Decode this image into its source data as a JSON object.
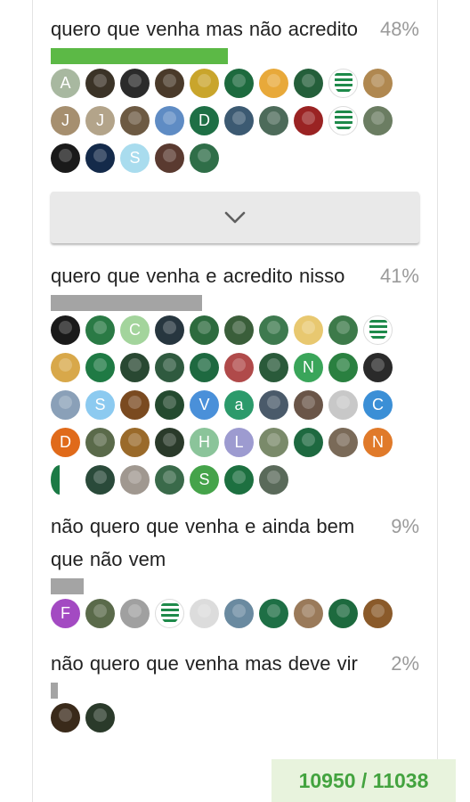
{
  "poll": {
    "options": [
      {
        "label": "quero que venha mas não acredito",
        "percent": "48%",
        "bar_fraction": 0.48,
        "bar_color": "#5cb946",
        "voters": [
          {
            "type": "initial",
            "text": "A",
            "color": "#a8b8a0"
          },
          {
            "type": "photo",
            "color": "#3b3327"
          },
          {
            "type": "photo",
            "color": "#2b2b2b"
          },
          {
            "type": "photo",
            "color": "#4a3a2a"
          },
          {
            "type": "photo",
            "color": "#c9a52c"
          },
          {
            "type": "photo",
            "color": "#1d6a3e"
          },
          {
            "type": "photo",
            "color": "#e8a93a"
          },
          {
            "type": "photo",
            "color": "#245f3a"
          },
          {
            "type": "crest"
          },
          {
            "type": "photo",
            "color": "#b08850"
          },
          {
            "type": "initial",
            "text": "J",
            "color": "#a68f6f"
          },
          {
            "type": "initial",
            "text": "J",
            "color": "#b3a48a"
          },
          {
            "type": "photo",
            "color": "#6d5a43"
          },
          {
            "type": "photo",
            "color": "#5f8cc4"
          },
          {
            "type": "initial",
            "text": "D",
            "color": "#1e6f45"
          },
          {
            "type": "photo",
            "color": "#3c5a72"
          },
          {
            "type": "photo",
            "color": "#4d6b5a"
          },
          {
            "type": "photo",
            "color": "#9a2323"
          },
          {
            "type": "crest"
          },
          {
            "type": "photo",
            "color": "#6b7d62"
          },
          {
            "type": "photo",
            "color": "#1a1a1a"
          },
          {
            "type": "photo",
            "color": "#142a4a"
          },
          {
            "type": "initial",
            "text": "S",
            "color": "#a9dcee"
          },
          {
            "type": "photo",
            "color": "#5a3a30"
          },
          {
            "type": "photo",
            "color": "#2f6e48"
          }
        ]
      },
      {
        "label": "quero que venha e acredito nisso",
        "percent": "41%",
        "bar_fraction": 0.41,
        "bar_color": "#a4a4a4",
        "voters": [
          {
            "type": "photo",
            "color": "#1a1a1a"
          },
          {
            "type": "photo",
            "color": "#2a7a45"
          },
          {
            "type": "initial",
            "text": "C",
            "color": "#a3d49c"
          },
          {
            "type": "photo",
            "color": "#27363f"
          },
          {
            "type": "photo",
            "color": "#2d6b3e"
          },
          {
            "type": "photo",
            "color": "#3a5e3a"
          },
          {
            "type": "photo",
            "color": "#3e7a4f"
          },
          {
            "type": "photo",
            "color": "#e8c870"
          },
          {
            "type": "photo",
            "color": "#3d7a4a"
          },
          {
            "type": "crest"
          },
          {
            "type": "photo",
            "color": "#d8a84a"
          },
          {
            "type": "photo",
            "color": "#1f7a44"
          },
          {
            "type": "photo",
            "color": "#294832"
          },
          {
            "type": "photo",
            "color": "#2f5a3f"
          },
          {
            "type": "photo",
            "color": "#1e6940"
          },
          {
            "type": "photo",
            "color": "#b04a4a"
          },
          {
            "type": "photo",
            "color": "#2a5a3a"
          },
          {
            "type": "initial",
            "text": "N",
            "color": "#3aa55a"
          },
          {
            "type": "photo",
            "color": "#2a8040"
          },
          {
            "type": "photo",
            "color": "#2a2a2a"
          },
          {
            "type": "photo",
            "color": "#8aa0b8"
          },
          {
            "type": "initial",
            "text": "S",
            "color": "#8ccaf0"
          },
          {
            "type": "photo",
            "color": "#7a4a20"
          },
          {
            "type": "photo",
            "color": "#244a2f"
          },
          {
            "type": "initial",
            "text": "V",
            "color": "#4a90d9"
          },
          {
            "type": "initial",
            "text": "a",
            "color": "#2c9a6b"
          },
          {
            "type": "photo",
            "color": "#4a5a6a"
          },
          {
            "type": "photo",
            "color": "#6a5548"
          },
          {
            "type": "photo",
            "color": "#c8c8c8"
          },
          {
            "type": "initial",
            "text": "C",
            "color": "#3b8fd6"
          },
          {
            "type": "initial",
            "text": "D",
            "color": "#e06a1a"
          },
          {
            "type": "photo",
            "color": "#5a6a4a"
          },
          {
            "type": "photo",
            "color": "#9a6a2a"
          },
          {
            "type": "photo",
            "color": "#2a3a2a"
          },
          {
            "type": "initial",
            "text": "H",
            "color": "#8bc49a"
          },
          {
            "type": "initial",
            "text": "L",
            "color": "#9d9bd0"
          },
          {
            "type": "photo",
            "color": "#7a8a6a"
          },
          {
            "type": "photo",
            "color": "#1e6940"
          },
          {
            "type": "photo",
            "color": "#7a6a58"
          },
          {
            "type": "initial",
            "text": "N",
            "color": "#e07a2a"
          },
          {
            "type": "half"
          },
          {
            "type": "photo",
            "color": "#2a4a3a"
          },
          {
            "type": "photo",
            "color": "#a09890"
          },
          {
            "type": "photo",
            "color": "#3a6a4a"
          },
          {
            "type": "initial",
            "text": "S",
            "color": "#45a34a"
          },
          {
            "type": "photo",
            "color": "#1d7040"
          },
          {
            "type": "photo",
            "color": "#5a6a5a"
          }
        ]
      },
      {
        "label": "não quero que venha e ainda bem que não vem",
        "percent": "9%",
        "bar_fraction": 0.09,
        "bar_color": "#a4a4a4",
        "voters": [
          {
            "type": "initial",
            "text": "F",
            "color": "#a34ac2"
          },
          {
            "type": "photo",
            "color": "#5a6a4a"
          },
          {
            "type": "photo",
            "color": "#a0a0a0"
          },
          {
            "type": "crest"
          },
          {
            "type": "photo",
            "color": "#dcdcdc"
          },
          {
            "type": "photo",
            "color": "#6a8aa0"
          },
          {
            "type": "photo",
            "color": "#1e6f45"
          },
          {
            "type": "photo",
            "color": "#9a7a5a"
          },
          {
            "type": "photo",
            "color": "#1d6a3e"
          },
          {
            "type": "photo",
            "color": "#8a5a2a"
          }
        ]
      },
      {
        "label": "não quero que venha mas deve vir",
        "percent": "2%",
        "bar_fraction": 0.02,
        "bar_color": "#a4a4a4",
        "voters": [
          {
            "type": "photo",
            "color": "#3a2a1a"
          },
          {
            "type": "photo",
            "color": "#2a3a2a"
          }
        ]
      }
    ],
    "expand_icon": "chevron-down-icon"
  },
  "counter": {
    "text": "10950 / 11038"
  },
  "colors": {
    "accent_green": "#5cb946",
    "counter_bg": "#e8f3dd",
    "counter_text": "#43a33f"
  }
}
